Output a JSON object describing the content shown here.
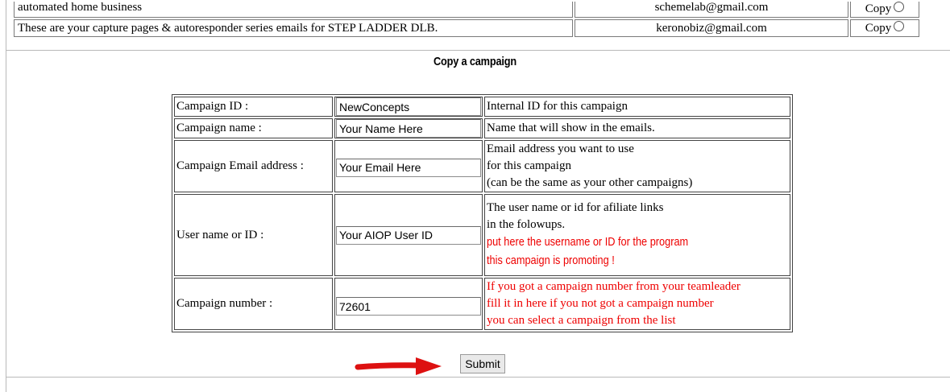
{
  "campaigns": [
    {
      "description": "automated home business",
      "email": "schemelab@gmail.com",
      "action": "Copy"
    },
    {
      "description": "These are your capture pages & autoresponder series emails for STEP LADDER DLB.",
      "email": "keronobiz@gmail.com",
      "action": "Copy"
    }
  ],
  "section_title": "Copy a campaign",
  "form": {
    "campaign_id": {
      "label": "Campaign ID :",
      "value": "NewConcepts",
      "note": [
        "Internal ID for this campaign"
      ]
    },
    "campaign_name": {
      "label": "Campaign name :",
      "value": "Your Name Here",
      "note": [
        "Name that will show in the emails."
      ]
    },
    "campaign_email": {
      "label": "Campaign Email address :",
      "value": "Your Email Here",
      "note": [
        "Email address you want to use",
        "for this campaign",
        "(can be the same as your other campaigns)"
      ]
    },
    "user_name": {
      "label": "User name or ID :",
      "value": "Your AIOP User ID",
      "note": [
        "The user name or id for afiliate links",
        "in the folowups."
      ],
      "note_red": [
        "put here the username or ID for the program",
        "this campaign is promoting !"
      ]
    },
    "campaign_number": {
      "label": "Campaign number :",
      "value": "72601",
      "note_red": [
        "If you got a campaign number from your teamleader",
        "fill it in here if you not got a campaign number",
        "you can select a campaign from the list"
      ]
    }
  },
  "submit_label": "Submit",
  "colors": {
    "accent_red": "#ee0000",
    "arrow_red": "#dd1111"
  }
}
